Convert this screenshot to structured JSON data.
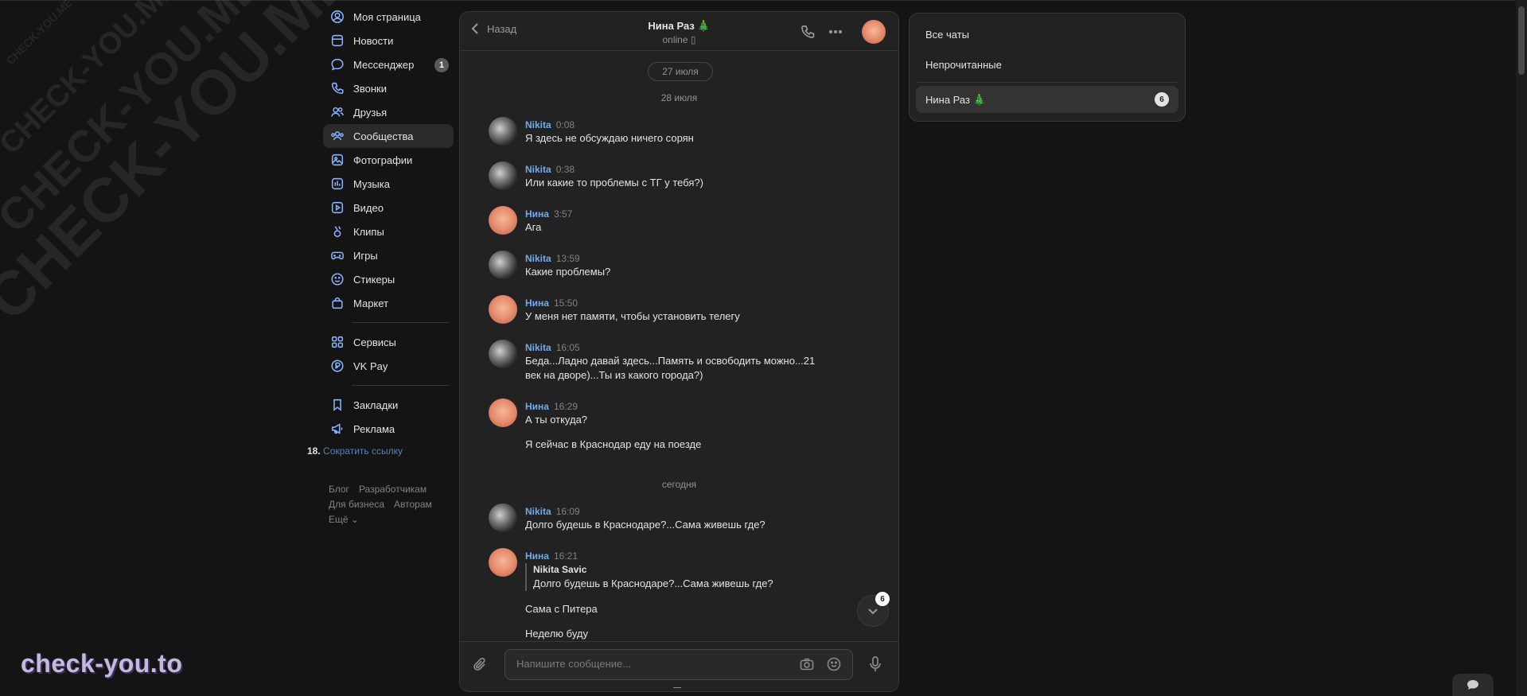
{
  "watermark": {
    "text": "CHECK-YOU.ME",
    "brand": "check-you.to"
  },
  "nav": {
    "items": [
      {
        "label": "Моя страница",
        "icon": "user-circle-icon"
      },
      {
        "label": "Новости",
        "icon": "news-icon"
      },
      {
        "label": "Мессенджер",
        "icon": "message-icon",
        "badge": "1"
      },
      {
        "label": "Звонки",
        "icon": "phone-icon"
      },
      {
        "label": "Друзья",
        "icon": "friends-icon"
      },
      {
        "label": "Сообщества",
        "icon": "communities-icon",
        "active": true
      },
      {
        "label": "Фотографии",
        "icon": "photo-icon"
      },
      {
        "label": "Музыка",
        "icon": "music-icon"
      },
      {
        "label": "Видео",
        "icon": "video-icon"
      },
      {
        "label": "Клипы",
        "icon": "clips-icon"
      },
      {
        "label": "Игры",
        "icon": "gamepad-icon"
      },
      {
        "label": "Стикеры",
        "icon": "sticker-icon"
      },
      {
        "label": "Маркет",
        "icon": "market-bag-icon"
      }
    ],
    "items2": [
      {
        "label": "Сервисы",
        "icon": "grid-icon"
      },
      {
        "label": "VK Pay",
        "icon": "vkpay-icon"
      }
    ],
    "items3": [
      {
        "label": "Закладки",
        "icon": "bookmark-icon"
      },
      {
        "label": "Реклама",
        "icon": "megaphone-icon"
      }
    ],
    "shorten": {
      "num": "18.",
      "link": "Сократить ссылку"
    },
    "footer": [
      "Блог",
      "Разработчикам",
      "Для бизнеса",
      "Авторам",
      "Ещё ⌄"
    ]
  },
  "chat": {
    "back": "Назад",
    "title": "Нина Раз 🎄",
    "status": "online",
    "date_pill": "27 июля",
    "date_sep_1": "28 июля",
    "date_sep_2": "сегодня",
    "messages": [
      {
        "author": "Nikita",
        "time": "0:08",
        "avatar": "nikita",
        "text": "Я здесь не обсуждаю ничего сорян"
      },
      {
        "author": "Nikita",
        "time": "0:38",
        "avatar": "nikita",
        "text": "Или какие то проблемы с ТГ у тебя?)"
      },
      {
        "author": "Нина",
        "time": "3:57",
        "avatar": "nina",
        "text": "Ага"
      },
      {
        "author": "Nikita",
        "time": "13:59",
        "avatar": "nikita",
        "text": "Какие проблемы?"
      },
      {
        "author": "Нина",
        "time": "15:50",
        "avatar": "nina",
        "text": "У меня нет памяти, чтобы установить телегу"
      },
      {
        "author": "Nikita",
        "time": "16:05",
        "avatar": "nikita",
        "text": "Беда...Ладно давай здесь...Память и освободить можно...21 век на дворе)...Ты из какого города?)"
      },
      {
        "author": "Нина",
        "time": "16:29",
        "avatar": "nina",
        "text": "А ты откуда?",
        "text2": "Я сейчас в Краснодар еду на поезде"
      },
      {
        "author": "Nikita",
        "time": "16:09",
        "avatar": "nikita",
        "text": "Долго будешь в Краснодаре?...Сама живешь где?"
      },
      {
        "author": "Нина",
        "time": "16:21",
        "avatar": "nina",
        "reply_name": "Nikita Savic",
        "reply_text": "Долго будешь в Краснодаре?...Сама живешь где?",
        "text": "Сама с Питера",
        "text2": "Неделю буду"
      }
    ],
    "scroll_badge": "6",
    "composer": {
      "placeholder": "Напишите сообщение..."
    }
  },
  "filters": {
    "all": "Все чаты",
    "unread": "Непрочитанные",
    "chat_name": "Нина Раз 🎄",
    "chat_badge": "6"
  }
}
